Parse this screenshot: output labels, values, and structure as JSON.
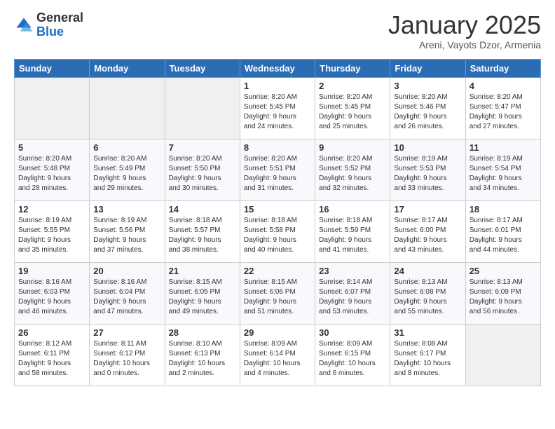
{
  "logo": {
    "general": "General",
    "blue": "Blue"
  },
  "header": {
    "title": "January 2025",
    "subtitle": "Areni, Vayots Dzor, Armenia"
  },
  "weekdays": [
    "Sunday",
    "Monday",
    "Tuesday",
    "Wednesday",
    "Thursday",
    "Friday",
    "Saturday"
  ],
  "weeks": [
    [
      {
        "day": "",
        "info": ""
      },
      {
        "day": "",
        "info": ""
      },
      {
        "day": "",
        "info": ""
      },
      {
        "day": "1",
        "info": "Sunrise: 8:20 AM\nSunset: 5:45 PM\nDaylight: 9 hours\nand 24 minutes."
      },
      {
        "day": "2",
        "info": "Sunrise: 8:20 AM\nSunset: 5:45 PM\nDaylight: 9 hours\nand 25 minutes."
      },
      {
        "day": "3",
        "info": "Sunrise: 8:20 AM\nSunset: 5:46 PM\nDaylight: 9 hours\nand 26 minutes."
      },
      {
        "day": "4",
        "info": "Sunrise: 8:20 AM\nSunset: 5:47 PM\nDaylight: 9 hours\nand 27 minutes."
      }
    ],
    [
      {
        "day": "5",
        "info": "Sunrise: 8:20 AM\nSunset: 5:48 PM\nDaylight: 9 hours\nand 28 minutes."
      },
      {
        "day": "6",
        "info": "Sunrise: 8:20 AM\nSunset: 5:49 PM\nDaylight: 9 hours\nand 29 minutes."
      },
      {
        "day": "7",
        "info": "Sunrise: 8:20 AM\nSunset: 5:50 PM\nDaylight: 9 hours\nand 30 minutes."
      },
      {
        "day": "8",
        "info": "Sunrise: 8:20 AM\nSunset: 5:51 PM\nDaylight: 9 hours\nand 31 minutes."
      },
      {
        "day": "9",
        "info": "Sunrise: 8:20 AM\nSunset: 5:52 PM\nDaylight: 9 hours\nand 32 minutes."
      },
      {
        "day": "10",
        "info": "Sunrise: 8:19 AM\nSunset: 5:53 PM\nDaylight: 9 hours\nand 33 minutes."
      },
      {
        "day": "11",
        "info": "Sunrise: 8:19 AM\nSunset: 5:54 PM\nDaylight: 9 hours\nand 34 minutes."
      }
    ],
    [
      {
        "day": "12",
        "info": "Sunrise: 8:19 AM\nSunset: 5:55 PM\nDaylight: 9 hours\nand 35 minutes."
      },
      {
        "day": "13",
        "info": "Sunrise: 8:19 AM\nSunset: 5:56 PM\nDaylight: 9 hours\nand 37 minutes."
      },
      {
        "day": "14",
        "info": "Sunrise: 8:18 AM\nSunset: 5:57 PM\nDaylight: 9 hours\nand 38 minutes."
      },
      {
        "day": "15",
        "info": "Sunrise: 8:18 AM\nSunset: 5:58 PM\nDaylight: 9 hours\nand 40 minutes."
      },
      {
        "day": "16",
        "info": "Sunrise: 8:18 AM\nSunset: 5:59 PM\nDaylight: 9 hours\nand 41 minutes."
      },
      {
        "day": "17",
        "info": "Sunrise: 8:17 AM\nSunset: 6:00 PM\nDaylight: 9 hours\nand 43 minutes."
      },
      {
        "day": "18",
        "info": "Sunrise: 8:17 AM\nSunset: 6:01 PM\nDaylight: 9 hours\nand 44 minutes."
      }
    ],
    [
      {
        "day": "19",
        "info": "Sunrise: 8:16 AM\nSunset: 6:03 PM\nDaylight: 9 hours\nand 46 minutes."
      },
      {
        "day": "20",
        "info": "Sunrise: 8:16 AM\nSunset: 6:04 PM\nDaylight: 9 hours\nand 47 minutes."
      },
      {
        "day": "21",
        "info": "Sunrise: 8:15 AM\nSunset: 6:05 PM\nDaylight: 9 hours\nand 49 minutes."
      },
      {
        "day": "22",
        "info": "Sunrise: 8:15 AM\nSunset: 6:06 PM\nDaylight: 9 hours\nand 51 minutes."
      },
      {
        "day": "23",
        "info": "Sunrise: 8:14 AM\nSunset: 6:07 PM\nDaylight: 9 hours\nand 53 minutes."
      },
      {
        "day": "24",
        "info": "Sunrise: 8:13 AM\nSunset: 6:08 PM\nDaylight: 9 hours\nand 55 minutes."
      },
      {
        "day": "25",
        "info": "Sunrise: 8:13 AM\nSunset: 6:09 PM\nDaylight: 9 hours\nand 56 minutes."
      }
    ],
    [
      {
        "day": "26",
        "info": "Sunrise: 8:12 AM\nSunset: 6:11 PM\nDaylight: 9 hours\nand 58 minutes."
      },
      {
        "day": "27",
        "info": "Sunrise: 8:11 AM\nSunset: 6:12 PM\nDaylight: 10 hours\nand 0 minutes."
      },
      {
        "day": "28",
        "info": "Sunrise: 8:10 AM\nSunset: 6:13 PM\nDaylight: 10 hours\nand 2 minutes."
      },
      {
        "day": "29",
        "info": "Sunrise: 8:09 AM\nSunset: 6:14 PM\nDaylight: 10 hours\nand 4 minutes."
      },
      {
        "day": "30",
        "info": "Sunrise: 8:09 AM\nSunset: 6:15 PM\nDaylight: 10 hours\nand 6 minutes."
      },
      {
        "day": "31",
        "info": "Sunrise: 8:08 AM\nSunset: 6:17 PM\nDaylight: 10 hours\nand 8 minutes."
      },
      {
        "day": "",
        "info": ""
      }
    ]
  ]
}
